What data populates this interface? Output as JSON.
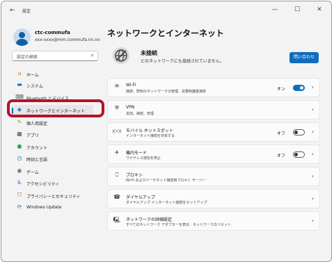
{
  "window": {
    "title": "設定",
    "back_glyph": "←",
    "minimize_glyph": "—",
    "maximize_glyph": "☐",
    "close_glyph": "✕"
  },
  "user": {
    "name": "ctc-commufa",
    "email": "xxx-xxxx@mm.commufa.nn.nn"
  },
  "search": {
    "placeholder": "設定の検索",
    "icon_glyph": "⌕"
  },
  "sidebar": {
    "items": [
      {
        "label": "ホーム",
        "icon": "home-icon",
        "glyph": "⌂",
        "color": "#d9731a"
      },
      {
        "label": "システム",
        "icon": "monitor-icon",
        "glyph": "▬",
        "color": "#0f6cbd"
      },
      {
        "label": "Bluetooth とデバイス",
        "icon": "bluetooth-devices-icon",
        "glyph": "⌨",
        "color": "#555555"
      },
      {
        "label": "ネットワークとインターネット",
        "icon": "network-icon",
        "glyph": "◆",
        "color": "#2a8ad8"
      },
      {
        "label": "個人用設定",
        "icon": "brush-icon",
        "glyph": "✎",
        "color": "#c9832d"
      },
      {
        "label": "アプリ",
        "icon": "apps-icon",
        "glyph": "▦",
        "color": "#4a4a6a"
      },
      {
        "label": "アカウント",
        "icon": "account-icon",
        "glyph": "●",
        "color": "#2fa36b"
      },
      {
        "label": "時刻と言語",
        "icon": "clock-globe-icon",
        "glyph": "◷",
        "color": "#0f6cbd"
      },
      {
        "label": "ゲーム",
        "icon": "controller-icon",
        "glyph": "◉",
        "color": "#666666"
      },
      {
        "label": "アクセシビリティ",
        "icon": "accessibility-icon",
        "glyph": "♿",
        "color": "#1a5fb0"
      },
      {
        "label": "プライバシーとセキュリティ",
        "icon": "shield-icon",
        "glyph": "⛉",
        "color": "#777777"
      },
      {
        "label": "Windows Update",
        "icon": "update-icon",
        "glyph": "⟳",
        "color": "#0f6cbd"
      }
    ],
    "active_index": 3
  },
  "main": {
    "title": "ネットワークとインターネット",
    "status": {
      "title": "未接続",
      "subtitle": "どのネットワークにも接続されていません。",
      "button": "問い合わせ"
    },
    "cards": [
      {
        "title": "Wi-Fi",
        "subtitle": "接続、既知のネットワークの管理、従量制課金接続",
        "icon": "wifi-icon",
        "glyph": "≋",
        "toggle": "on",
        "toggle_label": "オン"
      },
      {
        "title": "VPN",
        "subtitle": "追加、接続、管理",
        "icon": "vpn-icon",
        "glyph": "⛨",
        "toggle": null
      },
      {
        "title": "モバイル ホットスポット",
        "subtitle": "インターネット接続を共有する",
        "icon": "hotspot-icon",
        "glyph": "((•))",
        "toggle": "off",
        "toggle_label": "オフ"
      },
      {
        "title": "機内モード",
        "subtitle": "ワイヤレス通信を停止",
        "icon": "airplane-icon",
        "glyph": "✈",
        "toggle": "off",
        "toggle_label": "オフ"
      },
      {
        "title": "プロキシ",
        "subtitle": "Wi-Fi およびイーサネット接続用プロキシ サーバー",
        "icon": "proxy-icon",
        "glyph": "⎕",
        "toggle": null
      },
      {
        "title": "ダイヤルアップ",
        "subtitle": "ダイヤルアップ インターネット接続をセットアップ",
        "icon": "dialup-icon",
        "glyph": "☎",
        "toggle": null
      },
      {
        "title": "ネットワークの詳細設定",
        "subtitle": "すべてのネットワーク アダプターを表示、ネットワークのリセット",
        "icon": "advanced-network-icon",
        "glyph": "🖳",
        "toggle": null
      }
    ],
    "chevron_glyph": "›"
  },
  "colors": {
    "accent": "#0f6cbd",
    "highlight": "#b0152a"
  }
}
